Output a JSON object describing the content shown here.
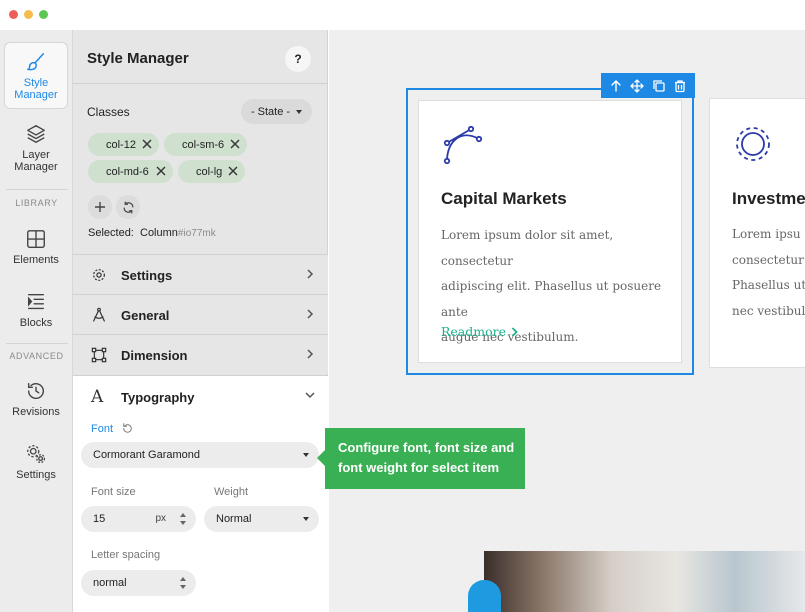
{
  "rail": {
    "style_manager": "Style\nManager",
    "layer_manager": "Layer\nManager",
    "library_heading": "LIBRARY",
    "elements": "Elements",
    "blocks": "Blocks",
    "advanced_heading": "ADVANCED",
    "revisions": "Revisions",
    "settings": "Settings"
  },
  "panel": {
    "title": "Style Manager",
    "help": "?",
    "classes_label": "Classes",
    "state_select": "- State -",
    "tags": [
      "col-12",
      "col-sm-6",
      "col-md-6",
      "col-lg"
    ],
    "selected_label": "Selected:",
    "selected_value": "Column",
    "selected_id": "#io77mk",
    "sections": {
      "settings": "Settings",
      "general": "General",
      "dimension": "Dimension",
      "typography": "Typography"
    },
    "typography": {
      "font_label": "Font",
      "font_value": "Cormorant Garamond",
      "font_size_label": "Font size",
      "font_size_value": "15",
      "font_size_unit": "px",
      "weight_label": "Weight",
      "weight_value": "Normal",
      "letter_spacing_label": "Letter spacing",
      "letter_spacing_value": "normal"
    }
  },
  "tooltip": {
    "line1": "Configure font, font size and",
    "line2": "font weight for select item"
  },
  "canvas": {
    "card1": {
      "title": "Capital Markets",
      "text_lines": [
        "Lorem ipsum dolor sit amet, consectetur",
        "adipiscing elit. Phasellus ut posuere ante",
        "augue nec vestibulum."
      ],
      "link": "Readmore"
    },
    "card2": {
      "title": "Investme",
      "text_lines": [
        "Lorem ipsu",
        "consectetur",
        "Phasellus ut",
        "nec vestibul"
      ]
    }
  },
  "colors": {
    "accent": "#1e88e5",
    "tooltip_bg": "#3ab054",
    "link": "#19b28c",
    "tag_bg": "#cfe0cf"
  }
}
